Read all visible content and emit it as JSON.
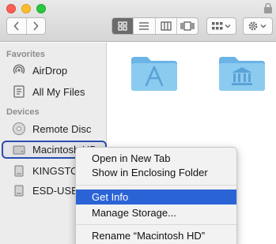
{
  "window": {
    "controls": [
      "close",
      "minimize",
      "zoom"
    ]
  },
  "toolbar": {
    "nav": {
      "back_icon": "chevron-left-icon",
      "forward_icon": "chevron-right-icon"
    },
    "views": [
      {
        "name": "icon-view-icon",
        "active": true
      },
      {
        "name": "list-view-icon",
        "active": false
      },
      {
        "name": "column-view-icon",
        "active": false
      },
      {
        "name": "gallery-view-icon",
        "active": false
      }
    ],
    "arrange_icon": "grid-arrange-icon",
    "action_icon": "gear-icon"
  },
  "sidebar": {
    "favorites_header": "Favorites",
    "favorites": [
      {
        "label": "AirDrop",
        "icon": "airdrop-icon"
      },
      {
        "label": "All My Files",
        "icon": "files-icon"
      }
    ],
    "devices_header": "Devices",
    "devices": [
      {
        "label": "Remote Disc",
        "icon": "disc-icon"
      },
      {
        "label": "Macintosh HD",
        "icon": "hard-drive-icon",
        "selected": true
      },
      {
        "label": "KINGSTON",
        "icon": "external-drive-icon"
      },
      {
        "label": "ESD-USB",
        "icon": "external-drive-icon"
      }
    ]
  },
  "content": {
    "folders": [
      {
        "icon": "applications-folder-icon"
      },
      {
        "icon": "library-folder-icon"
      }
    ]
  },
  "context_menu": {
    "items": [
      {
        "label": "Open in New Tab"
      },
      {
        "label": "Show in Enclosing Folder"
      },
      {
        "label": "Get Info",
        "highlighted": true
      },
      {
        "label": "Manage Storage..."
      },
      {
        "label": "Rename “Macintosh HD”"
      }
    ]
  },
  "colors": {
    "selection": "#2a63d6",
    "folder": "#7fc1ec",
    "sidebar_bg": "#ececec"
  }
}
